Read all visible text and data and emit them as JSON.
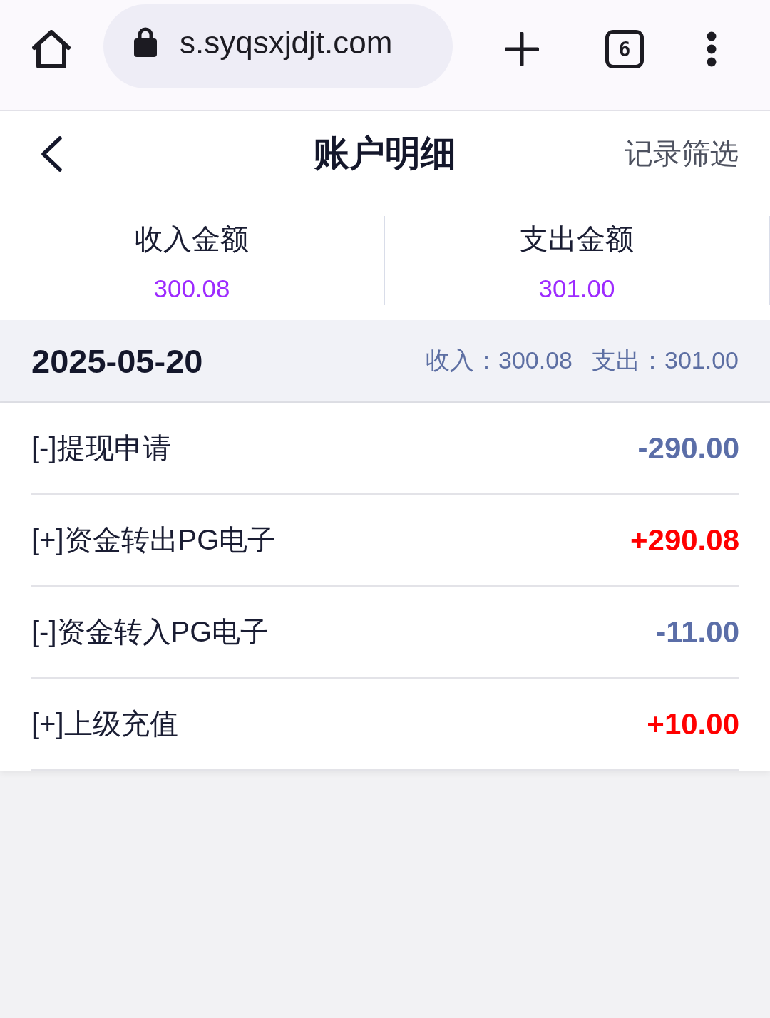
{
  "browser": {
    "url": "s.syqsxjdjt.com",
    "tab_count": "6"
  },
  "header": {
    "title": "账户明细",
    "action": "记录筛选"
  },
  "summary": [
    {
      "label": "收入金额",
      "value": "300.08"
    },
    {
      "label": "支出金额",
      "value": "301.00"
    }
  ],
  "day": {
    "date": "2025-05-20",
    "totals": [
      "收入：300.08",
      "支出：301.00"
    ]
  },
  "records": [
    {
      "title": "[-]提现申请",
      "amount": "-290.00",
      "kind": "expense"
    },
    {
      "title": "[+]资金转出PG电子",
      "amount": "+290.08",
      "kind": "income"
    },
    {
      "title": "[-]资金转入PG电子",
      "amount": "-11.00",
      "kind": "expense"
    },
    {
      "title": "[+]上级充值",
      "amount": "+10.00",
      "kind": "income"
    }
  ]
}
